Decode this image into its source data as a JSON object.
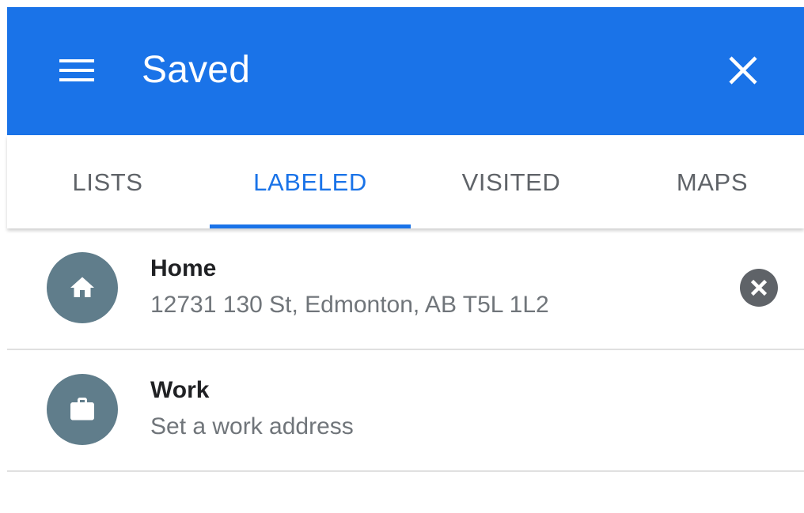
{
  "header": {
    "title": "Saved",
    "background": "#1a73e8",
    "menu_icon": "hamburger-menu-icon",
    "close_icon": "close-icon"
  },
  "tabs": [
    {
      "label": "LISTS",
      "active": false
    },
    {
      "label": "LABELED",
      "active": true
    },
    {
      "label": "VISITED",
      "active": false
    },
    {
      "label": "MAPS",
      "active": false
    }
  ],
  "accent_color": "#1a73e8",
  "items": [
    {
      "title": "Home",
      "subtitle": "12731 130 St, Edmonton, AB T5L 1L2",
      "icon": "home-icon",
      "removable": true,
      "remove_icon": "remove-circle-icon"
    },
    {
      "title": "Work",
      "subtitle": "Set a work address",
      "icon": "briefcase-icon",
      "removable": false
    }
  ],
  "colors": {
    "avatar": "#607d8b",
    "tab_inactive": "#5f6368",
    "text_primary": "#202124",
    "text_secondary": "#70757a"
  }
}
